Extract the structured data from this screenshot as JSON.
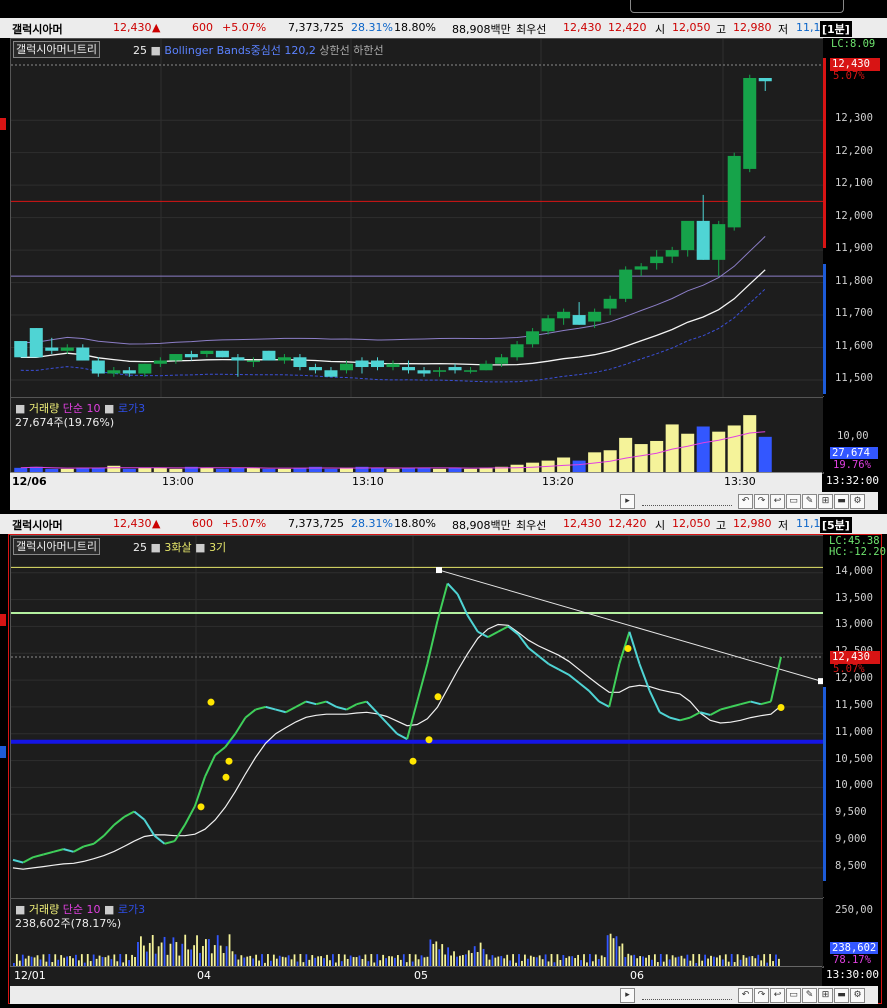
{
  "top_quote": {
    "name": "갤럭시아머",
    "price": "12,430",
    "up_arrow": "▲",
    "change": "600",
    "change_pct": "+5.07%",
    "volume": "7,373,725",
    "turnover_ratio": "28.31%",
    "strength": "18.80%",
    "amount": "88,908백만",
    "best_label": "최우선",
    "ask": "12,430",
    "bid": "12,420",
    "open_label": "시",
    "open": "12,050",
    "high_label": "고",
    "high": "12,980",
    "low_label": "저",
    "low": "11,1",
    "interval": "[1분]"
  },
  "bottom_quote": {
    "name": "갤럭시아머",
    "price": "12,430",
    "up_arrow": "▲",
    "change": "600",
    "change_pct": "+5.07%",
    "volume": "7,373,725",
    "turnover_ratio": "28.31%",
    "strength": "18.80%",
    "amount": "88,908백만",
    "best_label": "최우선",
    "ask": "12,430",
    "bid": "12,420",
    "open_label": "시",
    "open": "12,050",
    "high_label": "고",
    "high": "12,980",
    "low_label": "저",
    "low": "11,1",
    "interval": "[5분]"
  },
  "chart1": {
    "legend_symbol": "갤럭시아머니트리",
    "legend_period": "25",
    "legend_indicator": "Bollinger Bands중심선 120,2",
    "legend_upper": "상한선",
    "legend_lower": "하한선",
    "lc_label": "LC:8.09",
    "current_price": "12,430",
    "current_pct": "5.07%",
    "vol_legend_vol": "거래량",
    "vol_legend_ma": "단순 10",
    "vol_legend_extra": "로가3",
    "vol_value_text": "27,674주(19.76%)",
    "vol_axis_label": "10,00",
    "vol_current": "27,674",
    "vol_current_pct": "19.76%",
    "date_label": "12/06",
    "time_end": "13:32:00"
  },
  "chart2": {
    "legend_symbol": "갤럭시아머니트리",
    "legend_period": "25",
    "legend_indicator1": "3화살",
    "legend_indicator2": "3기",
    "lc_label": "LC:45.38",
    "hc_label": "HC:-12.20",
    "current_price": "12,430",
    "current_pct": "5.07%",
    "vol_legend_vol": "거래량",
    "vol_legend_ma": "단순 10",
    "vol_legend_extra": "로가3",
    "vol_value_text": "238,602주(78.17%)",
    "vol_axis_label": "250,00",
    "vol_current": "238,602",
    "vol_current_pct": "78.17%",
    "time_end": "13:30:00"
  },
  "chart_data": [
    {
      "type": "candlestick",
      "interval": "1분",
      "x_ticks": [
        "12/06",
        "13:00",
        "13:10",
        "13:20",
        "13:30"
      ],
      "y_ticks": [
        "12,300",
        "12,200",
        "12,100",
        "12,000",
        "11,900",
        "11,800",
        "11,700",
        "11,600",
        "11,500"
      ],
      "ylim": [
        11460,
        12470
      ],
      "candles": [
        [
          11620,
          11620,
          11570,
          11570
        ],
        [
          11660,
          11660,
          11570,
          11570
        ],
        [
          11600,
          11630,
          11580,
          11590
        ],
        [
          11590,
          11610,
          11580,
          11600
        ],
        [
          11600,
          11610,
          11560,
          11560
        ],
        [
          11560,
          11570,
          11510,
          11520
        ],
        [
          11520,
          11540,
          11510,
          11530
        ],
        [
          11530,
          11540,
          11510,
          11520
        ],
        [
          11520,
          11550,
          11510,
          11550
        ],
        [
          11550,
          11570,
          11540,
          11560
        ],
        [
          11560,
          11580,
          11550,
          11580
        ],
        [
          11580,
          11590,
          11560,
          11570
        ],
        [
          11580,
          11590,
          11570,
          11590
        ],
        [
          11590,
          11590,
          11570,
          11570
        ],
        [
          11570,
          11580,
          11510,
          11560
        ],
        [
          11560,
          11570,
          11540,
          11560
        ],
        [
          11590,
          11590,
          11560,
          11560
        ],
        [
          11560,
          11580,
          11550,
          11570
        ],
        [
          11570,
          11580,
          11530,
          11540
        ],
        [
          11540,
          11550,
          11520,
          11530
        ],
        [
          11530,
          11540,
          11510,
          11510
        ],
        [
          11530,
          11560,
          11520,
          11550
        ],
        [
          11560,
          11570,
          11520,
          11540
        ],
        [
          11560,
          11570,
          11530,
          11540
        ],
        [
          11540,
          11560,
          11530,
          11550
        ],
        [
          11540,
          11560,
          11520,
          11530
        ],
        [
          11530,
          11540,
          11510,
          11520
        ],
        [
          11530,
          11540,
          11510,
          11530
        ],
        [
          11540,
          11550,
          11520,
          11530
        ],
        [
          11530,
          11540,
          11520,
          11530
        ],
        [
          11530,
          11560,
          11530,
          11550
        ],
        [
          11550,
          11580,
          11540,
          11570
        ],
        [
          11570,
          11620,
          11560,
          11610
        ],
        [
          11610,
          11660,
          11600,
          11650
        ],
        [
          11650,
          11700,
          11640,
          11690
        ],
        [
          11690,
          11720,
          11670,
          11710
        ],
        [
          11700,
          11740,
          11670,
          11670
        ],
        [
          11680,
          11720,
          11660,
          11710
        ],
        [
          11720,
          11760,
          11700,
          11750
        ],
        [
          11750,
          11850,
          11740,
          11840
        ],
        [
          11840,
          11860,
          11820,
          11850
        ],
        [
          11860,
          11900,
          11840,
          11880
        ],
        [
          11880,
          11910,
          11860,
          11900
        ],
        [
          11900,
          11960,
          11880,
          11990
        ],
        [
          11990,
          12070,
          11870,
          11870
        ],
        [
          11870,
          11990,
          11820,
          11980
        ],
        [
          11970,
          12200,
          11960,
          12190
        ],
        [
          12150,
          12440,
          12140,
          12430
        ],
        [
          12430,
          12430,
          12390,
          12420
        ]
      ],
      "indicators": [
        "Bollinger Bands중심선 120,2",
        "상한선",
        "하한선"
      ],
      "volume": [
        0.5,
        0.6,
        0.4,
        0.4,
        0.5,
        0.5,
        0.7,
        0.4,
        0.5,
        0.5,
        0.4,
        0.6,
        0.5,
        0.4,
        0.5,
        0.5,
        0.4,
        0.4,
        0.5,
        0.6,
        0.4,
        0.5,
        0.6,
        0.5,
        0.4,
        0.5,
        0.5,
        0.4,
        0.5,
        0.4,
        0.5,
        0.6,
        0.8,
        1.0,
        1.2,
        1.5,
        1.2,
        2.0,
        2.2,
        3.4,
        2.8,
        3.1,
        4.7,
        3.8,
        4.5,
        4.0,
        4.6,
        5.6,
        3.5
      ],
      "volume_ma_label": "단순 10"
    },
    {
      "type": "line",
      "interval": "5분",
      "x_ticks": [
        "12/01",
        "04",
        "05",
        "06"
      ],
      "y_ticks": [
        "14,000",
        "13,500",
        "13,000",
        "12,500",
        "12,000",
        "11,500",
        "11,000",
        "10,500",
        "10,000",
        "9,500",
        "9,000",
        "8,500"
      ],
      "ylim": [
        8200,
        14200
      ],
      "series": [
        {
          "values": [
            8650,
            8600,
            8700,
            8750,
            8800,
            8850,
            8800,
            8900,
            8950,
            9100,
            9300,
            9450,
            9550,
            9400,
            9100,
            8950,
            9000,
            9300,
            9650,
            10200,
            10600,
            10750,
            11000,
            11300,
            11450,
            11500,
            11450,
            11400,
            11500,
            11600,
            11550,
            11600,
            11500,
            11450,
            11550,
            11600,
            11400,
            11200,
            11000,
            10900,
            11600,
            12300,
            13100,
            13800,
            13600,
            13200,
            12900,
            12800,
            12900,
            13000,
            12850,
            12600,
            12450,
            12300,
            12200,
            12100,
            11950,
            11800,
            11600,
            11500,
            12300,
            12900,
            12300,
            11800,
            11400,
            11300,
            11250,
            11300,
            11400,
            11350,
            11450,
            11500,
            11550,
            11600,
            11550,
            11600,
            12430
          ]
        }
      ],
      "indicators": [
        "3화살",
        "3기"
      ],
      "horizontal_lines": [
        14100,
        13250,
        10850
      ],
      "trendline": [
        14050,
        11980
      ],
      "markers": [
        9750,
        10300,
        10600,
        10600,
        11000,
        11800,
        12700,
        11600,
        11700
      ]
    }
  ],
  "colors": {
    "up": "#16a34a",
    "down": "#4fd4d4",
    "vol_up": "#f5f39a",
    "vol_down": "#3357ff",
    "red_line": "#d81414",
    "violet_line": "#8c7ec7",
    "yellow_line": "#e6e66a",
    "green_line": "#b4f0a0",
    "blue_line": "#1515e6",
    "price_tag": "#d81414"
  }
}
